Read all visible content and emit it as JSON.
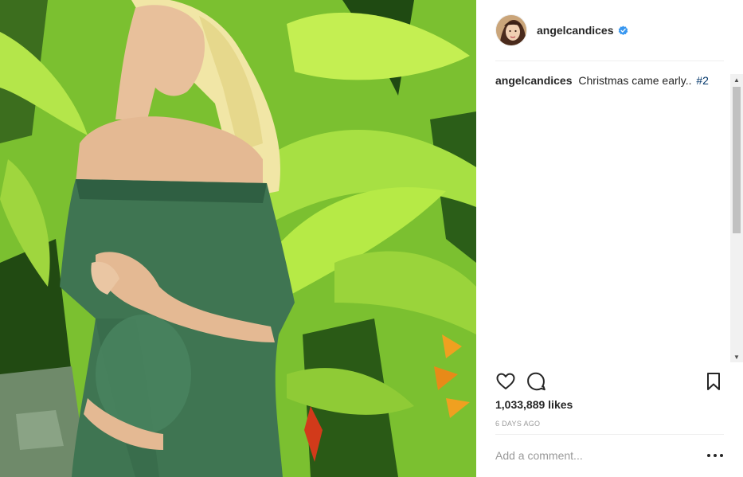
{
  "post": {
    "username": "angelcandices",
    "verified": true,
    "caption_user": "angelcandices",
    "caption_text": "Christmas came early..",
    "caption_hashtag": "#2",
    "likes": "1,033,889 likes",
    "timestamp": "6 DAYS AGO",
    "comment_placeholder": "Add a comment..."
  },
  "icons": {
    "like": "heart-outline-icon",
    "comment": "speech-bubble-icon",
    "save": "bookmark-icon",
    "more": "ellipsis-icon",
    "verified": "verified-badge-icon"
  },
  "colors": {
    "text": "#262626",
    "muted": "#999999",
    "hashtag": "#003569",
    "verified": "#3897f0",
    "divider": "#efefef"
  }
}
